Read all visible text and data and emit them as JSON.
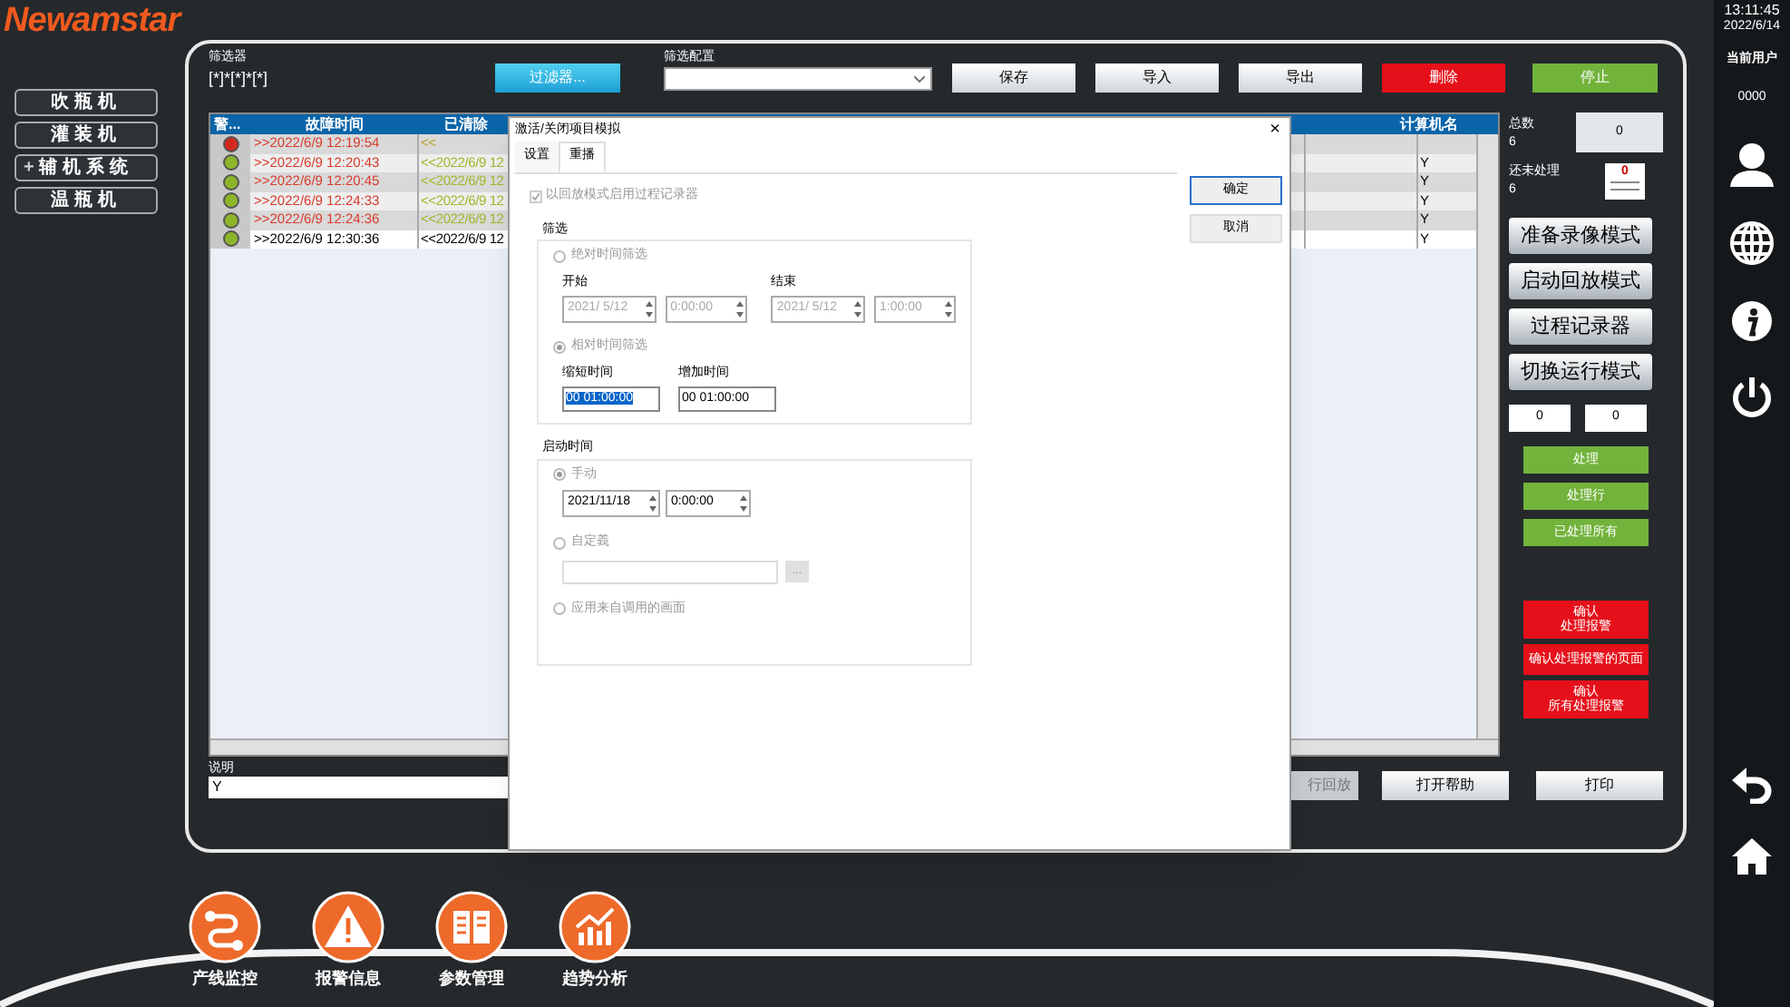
{
  "logo": "Newamstar",
  "nav": [
    {
      "label": "吹瓶机",
      "expandable": false
    },
    {
      "label": "灌装机",
      "expandable": false
    },
    {
      "label": "辅机系统",
      "expandable": true,
      "expander": "+"
    },
    {
      "label": "温瓶机",
      "expandable": false
    }
  ],
  "toolbar": {
    "filter_label": "筛选器",
    "filter_value": "[*]*[*]*[*]",
    "filter_button": "过滤器...",
    "config_label": "筛选配置",
    "buttons": [
      {
        "label": "保存",
        "kind": "normal"
      },
      {
        "label": "导入",
        "kind": "normal"
      },
      {
        "label": "导出",
        "kind": "normal"
      },
      {
        "label": "删除",
        "kind": "danger"
      },
      {
        "label": "停止",
        "kind": "go"
      }
    ]
  },
  "table": {
    "columns": [
      "警...",
      "故障时间",
      "已清除",
      "计算机名"
    ],
    "rows": [
      {
        "color": "#d42a1e",
        "time": ">>2022/6/9 12:19:54",
        "cleared": "<<",
        "kind": "active"
      },
      {
        "color": "#8db52a",
        "time": ">>2022/6/9 12:20:43",
        "cleared": "<<2022/6/9 12",
        "kind": "cleared",
        "flag": "Y"
      },
      {
        "color": "#8db52a",
        "time": ">>2022/6/9 12:20:45",
        "cleared": "<<2022/6/9 12",
        "kind": "cleared",
        "flag": "Y"
      },
      {
        "color": "#8db52a",
        "time": ">>2022/6/9 12:24:33",
        "cleared": "<<2022/6/9 12",
        "kind": "cleared",
        "flag": "Y"
      },
      {
        "color": "#8db52a",
        "time": ">>2022/6/9 12:24:36",
        "cleared": "<<2022/6/9 12",
        "kind": "cleared",
        "flag": "Y"
      },
      {
        "color": "#8db52a",
        "time": ">>2022/6/9 12:30:36",
        "cleared": "<<2022/6/9 12",
        "kind": "acknowledged",
        "flag": "Y"
      }
    ]
  },
  "description": {
    "label": "说明",
    "value": "Y"
  },
  "bottom_buttons": [
    {
      "label": "行回放",
      "disabled": true
    },
    {
      "label": "打开帮助",
      "disabled": false
    },
    {
      "label": "打印",
      "disabled": false
    }
  ],
  "summary": {
    "total_label": "总数",
    "total": "6",
    "total_box": "0",
    "pending_label": "还未处理",
    "pending": "6",
    "pending_icon_text": "0"
  },
  "mode_buttons": [
    "准备录像模式",
    "启动回放模式",
    "过程记录器",
    "切换运行模式"
  ],
  "counters": [
    "0",
    "0"
  ],
  "process_buttons": [
    "处理",
    "处理行",
    "已处理所有"
  ],
  "confirm_buttons": [
    {
      "lines": [
        "确认",
        "处理报警"
      ]
    },
    {
      "lines": [
        "确认处理报警的页面"
      ]
    },
    {
      "lines": [
        "确认",
        "所有处理报警"
      ]
    }
  ],
  "dialog": {
    "title": "激活/关闭项目模拟",
    "close": "×",
    "tabs": [
      {
        "label": "设置",
        "selected": false
      },
      {
        "label": "重播",
        "selected": true
      }
    ],
    "replay_checkbox": {
      "label": "以回放模式启用过程记录器",
      "checked": true,
      "disabled": true
    },
    "filter": {
      "title": "筛选",
      "absolute": {
        "label": "绝对时间筛选",
        "selected": false
      },
      "start_label": "开始",
      "end_label": "结束",
      "start_date": "2021/ 5/12",
      "start_time": "0:00:00",
      "end_date": "2021/ 5/12",
      "end_time": "1:00:00",
      "relative": {
        "label": "相对时间筛选",
        "selected": true
      },
      "shorten_label": "缩短时间",
      "shorten_value": "00 01:00:00",
      "extend_label": "增加时间",
      "extend_value": "00 01:00:00"
    },
    "start": {
      "title": "启动时间",
      "manual": {
        "label": "手动",
        "selected": true
      },
      "date": "2021/11/18",
      "time": "0:00:00",
      "custom": {
        "label": "自定義",
        "selected": false
      },
      "browse": "...",
      "from_screen": {
        "label": "应用来自调用的画面",
        "selected": false
      }
    },
    "buttons": [
      {
        "label": "确定",
        "focused": true
      },
      {
        "label": "取消",
        "focused": false
      }
    ]
  },
  "clock": {
    "time": "13:11:45",
    "date": "2022/6/14"
  },
  "user": {
    "label": "当前用户",
    "id": "0000"
  },
  "bottom_nav": [
    "产线监控",
    "报警信息",
    "参数管理",
    "趋势分析"
  ]
}
